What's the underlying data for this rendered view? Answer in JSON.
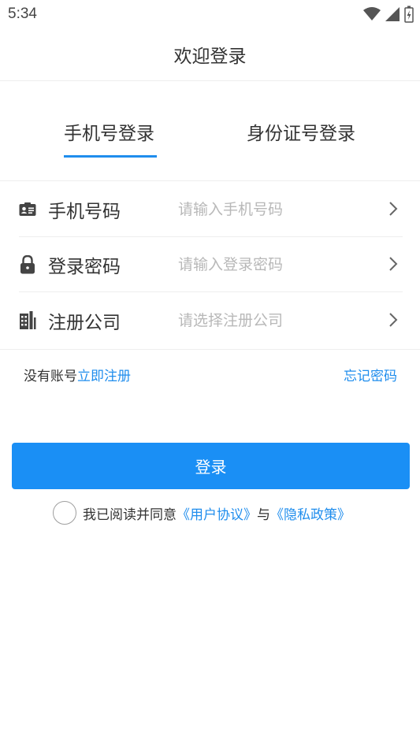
{
  "status_bar": {
    "time": "5:34"
  },
  "header": {
    "title": "欢迎登录"
  },
  "tabs": [
    {
      "label": "手机号登录",
      "active": true
    },
    {
      "label": "身份证号登录",
      "active": false
    }
  ],
  "form": {
    "phone": {
      "label": "手机号码",
      "placeholder": "请输入手机号码",
      "value": ""
    },
    "password": {
      "label": "登录密码",
      "placeholder": "请输入登录密码",
      "value": ""
    },
    "company": {
      "label": "注册公司",
      "placeholder": "请选择注册公司",
      "value": ""
    }
  },
  "links": {
    "no_account": "没有账号",
    "register": "立即注册",
    "forgot": "忘记密码"
  },
  "login_button": "登录",
  "agreement": {
    "prefix": "我已阅读并同意",
    "user_agreement": "《用户协议》",
    "and": "与",
    "privacy_policy": "《隐私政策》",
    "checked": false
  },
  "colors": {
    "accent": "#1f8ded",
    "button": "#1a8ff5",
    "divider": "#eeeeee",
    "placeholder": "#b8b8b8"
  }
}
